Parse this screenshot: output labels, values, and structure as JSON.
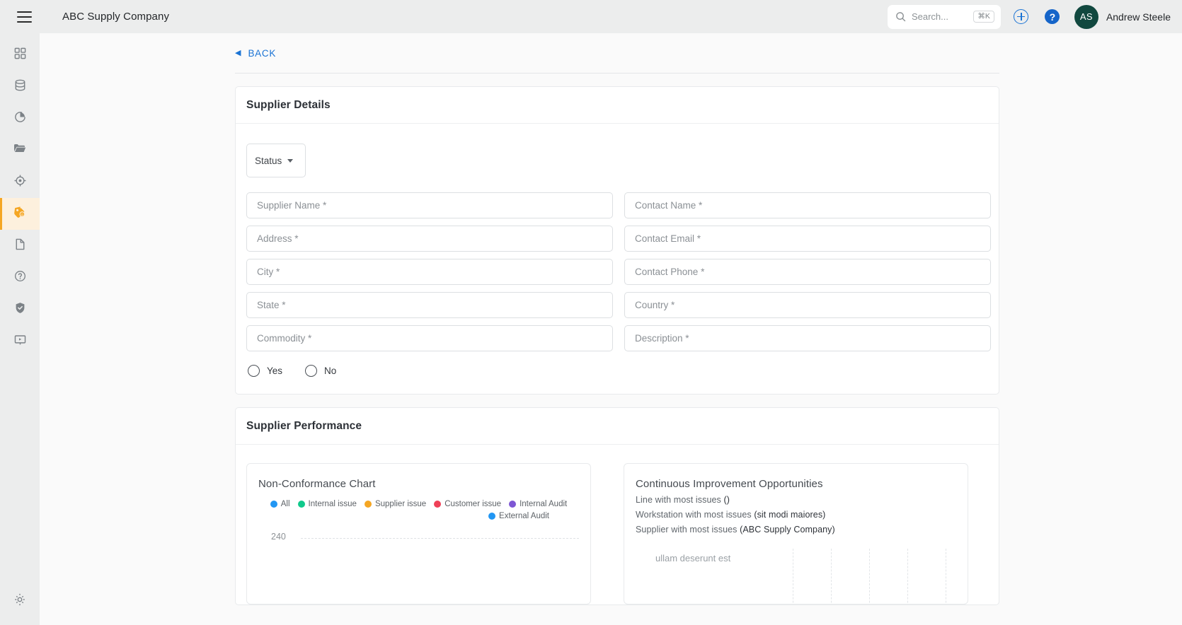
{
  "header": {
    "menu_icon": "hamburger-icon",
    "brand": "ABC Supply Company",
    "search": {
      "placeholder": "Search...",
      "shortcut": "⌘K",
      "icon": "search-icon"
    },
    "add_icon": "plus-circle-icon",
    "help_icon": "help-circle-icon",
    "help_glyph": "?",
    "user": {
      "initials": "AS",
      "name": "Andrew Steele"
    }
  },
  "sidebar": {
    "items": [
      {
        "name": "dashboard",
        "icon": "grid-icon",
        "active": false
      },
      {
        "name": "database",
        "icon": "database-icon",
        "active": false
      },
      {
        "name": "analytics",
        "icon": "pie-chart-icon",
        "active": false
      },
      {
        "name": "files",
        "icon": "folder-icon",
        "active": false
      },
      {
        "name": "targets",
        "icon": "target-icon",
        "active": false
      },
      {
        "name": "suppliers",
        "icon": "tag-icon",
        "active": true
      },
      {
        "name": "documents",
        "icon": "document-icon",
        "active": false
      },
      {
        "name": "help",
        "icon": "question-circle-icon",
        "active": false
      },
      {
        "name": "quality",
        "icon": "shield-check-icon",
        "active": false
      },
      {
        "name": "training",
        "icon": "monitor-play-icon",
        "active": false
      }
    ],
    "settings": {
      "name": "settings",
      "icon": "gear-icon"
    }
  },
  "main": {
    "back": {
      "label": "BACK",
      "icon": "chevron-left-icon"
    },
    "supplier_details": {
      "title": "Supplier Details",
      "status": {
        "label": "Status",
        "icon": "chevron-down-icon"
      },
      "fields": [
        {
          "name": "supplier-name",
          "placeholder": "Supplier Name *",
          "value": ""
        },
        {
          "name": "contact-name",
          "placeholder": "Contact Name *",
          "value": ""
        },
        {
          "name": "address",
          "placeholder": "Address *",
          "value": ""
        },
        {
          "name": "contact-email",
          "placeholder": "Contact Email *",
          "value": ""
        },
        {
          "name": "city",
          "placeholder": "City *",
          "value": ""
        },
        {
          "name": "contact-phone",
          "placeholder": "Contact Phone *",
          "value": ""
        },
        {
          "name": "state",
          "placeholder": "State *",
          "value": ""
        },
        {
          "name": "country",
          "placeholder": "Country *",
          "value": ""
        },
        {
          "name": "commodity",
          "placeholder": "Commodity *",
          "value": ""
        },
        {
          "name": "description",
          "placeholder": "Description *",
          "value": ""
        }
      ],
      "radios": [
        {
          "name": "yes",
          "label": "Yes",
          "selected": false
        },
        {
          "name": "no",
          "label": "No",
          "selected": false
        }
      ]
    },
    "supplier_performance": {
      "title": "Supplier Performance",
      "non_conformance": {
        "title": "Non-Conformance Chart"
      },
      "continuous_improvement": {
        "title": "Continuous Improvement Opportunities",
        "lines": [
          {
            "label": "Line with most issues",
            "value": "()"
          },
          {
            "label": "Workstation with most issues",
            "value": "(sit modi maiores)"
          },
          {
            "label": "Supplier with most issues",
            "value": "(ABC Supply Company)"
          }
        ]
      }
    }
  },
  "chart_data": [
    {
      "type": "line",
      "title": "Non-Conformance Chart",
      "xlabel": "",
      "ylabel": "",
      "ylim": [
        0,
        240
      ],
      "yticks": [
        240
      ],
      "ytick_labels": [
        "240"
      ],
      "grid": true,
      "legend_position": "top",
      "categories": [],
      "series": [
        {
          "name": "All",
          "color": "#2196f3",
          "values": []
        },
        {
          "name": "Internal issue",
          "color": "#10c98b",
          "values": []
        },
        {
          "name": "Supplier issue",
          "color": "#f5a623",
          "values": []
        },
        {
          "name": "Customer issue",
          "color": "#ef4158",
          "values": []
        },
        {
          "name": "Internal Audit",
          "color": "#7e57d4",
          "values": []
        },
        {
          "name": "External Audit",
          "color": "#2196f3",
          "values": []
        }
      ]
    },
    {
      "type": "bar",
      "title": "Continuous Improvement Opportunities",
      "xlabel": "",
      "ylabel": "",
      "grid": true,
      "legend_position": "none",
      "categories": [
        "ullam deserunt est"
      ],
      "values": [],
      "annotations": [
        "Line with most issues ()",
        "Workstation with most issues (sit modi maiores)",
        "Supplier with most issues (ABC Supply Company)"
      ]
    }
  ],
  "colors": {
    "accent_blue": "#1a73d4",
    "active_orange": "#f5a623",
    "avatar_bg": "#11483f",
    "header_bg": "#eceded",
    "page_bg": "#fafafa"
  }
}
